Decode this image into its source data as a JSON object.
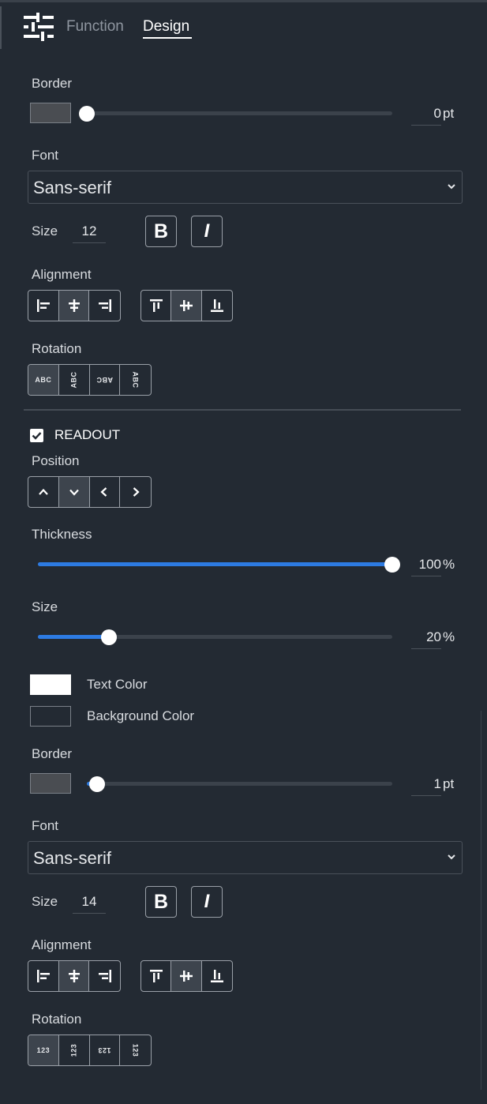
{
  "tabs": {
    "function": "Function",
    "design": "Design"
  },
  "section1": {
    "border_label": "Border",
    "border_value": "0",
    "border_unit": "pt",
    "border_slider_value": 0,
    "border_color": "#4a4d52",
    "font_label": "Font",
    "font_value": "Sans-serif",
    "size_label": "Size",
    "size_value": "12",
    "bold_label": "B",
    "italic_label": "I",
    "alignment_label": "Alignment",
    "rotation_label": "Rotation",
    "rotation_options": [
      "ABC",
      "ABC",
      "ABC",
      "ABC"
    ]
  },
  "readout": {
    "checkbox_label": "READOUT",
    "checked": true,
    "position_label": "Position",
    "thickness_label": "Thickness",
    "thickness_value": "100",
    "thickness_unit": "%",
    "thickness_percent": 100,
    "size_label": "Size",
    "size_value": "20",
    "size_unit": "%",
    "size_percent": 20,
    "text_color_label": "Text Color",
    "text_color": "#ffffff",
    "background_color_label": "Background Color",
    "background_color": "#232a33",
    "border_label": "Border",
    "border_value": "1",
    "border_unit": "pt",
    "border_color": "#4a4d52",
    "font_label": "Font",
    "font_value": "Sans-serif",
    "font_size_label": "Size",
    "font_size_value": "14",
    "bold_label": "B",
    "italic_label": "I",
    "alignment_label": "Alignment",
    "rotation_label": "Rotation",
    "rotation_options": [
      "123",
      "123",
      "123",
      "123"
    ]
  },
  "colors": {
    "accent": "#2d7be2",
    "background": "#232a33"
  }
}
